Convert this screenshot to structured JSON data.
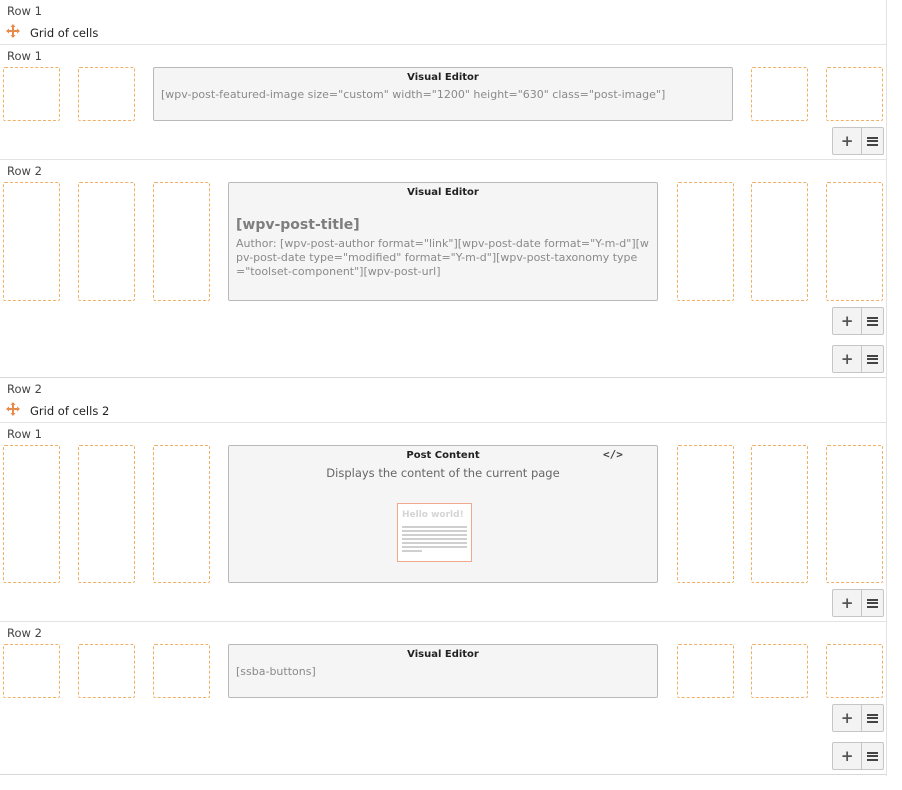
{
  "icons": {
    "move": "move-arrows-icon",
    "plus": "plus-icon",
    "menu": "hamburger-menu-icon",
    "code": "code-icon"
  },
  "colors": {
    "dashed_border": "#f0b066",
    "move_icon": "#e88a4a",
    "preview_border": "#f0a98a"
  },
  "outer_rows": [
    {
      "label": "Row 1",
      "grid_title": "Grid of cells",
      "inner_rows": [
        {
          "label": "Row 1",
          "cell_type": "Visual Editor",
          "content": "[wpv-post-featured-image size=\"custom\" width=\"1200\" height=\"630\" class=\"post-image\"]"
        },
        {
          "label": "Row 2",
          "cell_type": "Visual Editor",
          "heading": "[wpv-post-title]",
          "content": "Author: [wpv-post-author format=\"link\"][wpv-post-date format=\"Y-m-d\"][wpv-post-date type=\"modified\" format=\"Y-m-d\"][wpv-post-taxonomy type=\"toolset-component\"][wpv-post-url]"
        }
      ]
    },
    {
      "label": "Row 2",
      "grid_title": "Grid of cells 2",
      "inner_rows": [
        {
          "label": "Row 1",
          "cell_type": "Post Content",
          "description": "Displays the content of the current page",
          "preview_title": "Hello world!"
        },
        {
          "label": "Row 2",
          "cell_type": "Visual Editor",
          "content": "[ssba-buttons]"
        }
      ]
    }
  ],
  "buttons": {
    "add_label": "+"
  }
}
